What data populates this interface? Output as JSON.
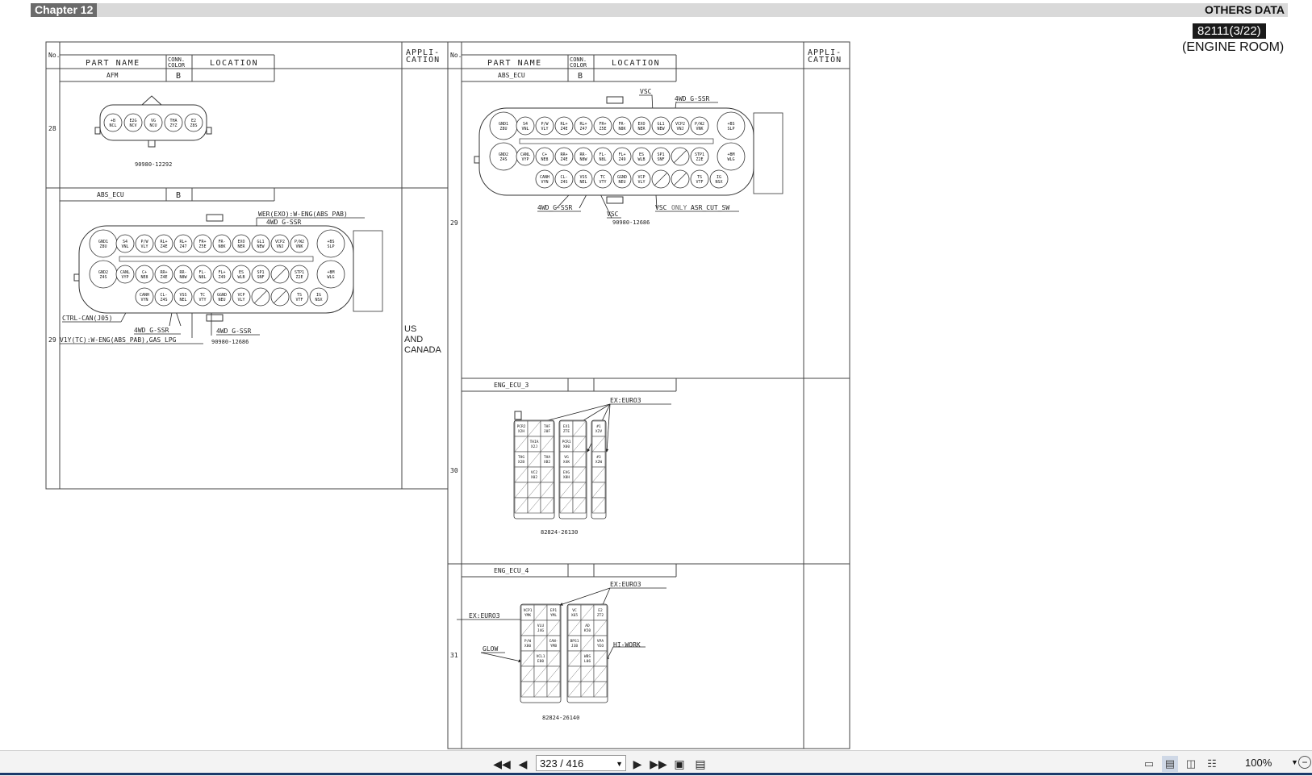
{
  "header": {
    "chapter": "Chapter 12",
    "section": "OTHERS DATA",
    "code": "82111(3/22)",
    "subtitle": "(ENGINE ROOM)"
  },
  "table": {
    "col_no": "No.",
    "col_part": "PART NAME",
    "col_conn1": "CONN.",
    "col_conn2": "COLOR",
    "col_location": "LOCATION",
    "col_app1": "APPLI-",
    "col_app2": "CATION"
  },
  "left": {
    "afm": {
      "no": "28",
      "part": "AFM",
      "color": "B",
      "partno": "90980-12292",
      "pins": [
        "+B\nNCL",
        "E2G\nNCV",
        "VG\nNCU",
        "THA\nZYZ",
        "E2\nZ8S"
      ]
    },
    "abs": {
      "no": "29",
      "part": "ABS_ECU",
      "color": "B",
      "partno": "90980-12686",
      "application": [
        "US",
        "AND",
        "CANADA"
      ],
      "callouts": [
        "WER(EXO):W-ENG(ABS_PAB)",
        "4WD_G-SSR",
        "CTRL-CAN(J05)",
        "4WD_G-SSR",
        "4WD_G-SSR",
        "V1Y(TC):W-ENG(ABS_PAB),GAS_LPG"
      ]
    }
  },
  "right": {
    "abs": {
      "no": "29",
      "part": "ABS_ECU",
      "color": "B",
      "partno": "90980-12686",
      "callouts": [
        "VSC",
        "4WD_G-SSR",
        "4WD_G-SSR",
        "VSC",
        "VSC",
        "ONLY",
        "ASR_CUT_SW"
      ]
    },
    "eng3": {
      "no": "30",
      "part": "ENG_ECU_3",
      "partno": "82824-26130",
      "callouts": [
        "EX:EURO3"
      ]
    },
    "eng4": {
      "no": "31",
      "part": "ENG_ECU_4",
      "partno": "82824-26140",
      "callouts": [
        "EX:EURO3",
        "EX:EURO3",
        "GLOW",
        "HI-WORK"
      ]
    }
  },
  "pins": {
    "abs_row1": [
      "GND1\nZ8U",
      "S4\nVNL",
      "P/W\nVLY",
      "RL+\nZ4E",
      "RL+\nZ47",
      "FR+\nZ5E",
      "FR-\nN8K",
      "EXO\nNER",
      "GL1\nNEW",
      "VCP2\nVNJ",
      "P/W2\nVNK",
      "+BS\nSLP"
    ],
    "abs_row2": [
      "GND2\nZ4S",
      "CANL\nVYP",
      "C+\nNE8",
      "RR+\nZ4E",
      "RR-\nN8W",
      "FL-\nN8L",
      "FL+\nZ49",
      "ES\nWLB",
      "SP1\nSNF",
      "",
      "STP1\nZ2E",
      "+BM\nWLG"
    ],
    "abs_row3": [
      "CANH\nVYN",
      "CL-\nZ4S",
      "VSS\nNEL",
      "TC\nVTY",
      "GGND\nNEU",
      "VCP\nVLY",
      "",
      "",
      "TS\nVTF",
      "IG\nNSX"
    ],
    "eng3_blocks": [
      "PCR2\nX2H",
      "THF\nJ0F",
      "THIA\nX2J",
      "THG\nX2B",
      "THA\nXB2",
      "VC2\nX02",
      "EX1\nZTE",
      "PCR1\nX00",
      "VG\nX4K",
      "EVG\nX8H",
      "INJF\nY81",
      "#1\nX2V",
      "#3\nX2W",
      "#2\nX2X",
      "#4\nXB1"
    ],
    "eng4_blocks": [
      "VCP1\nYMK",
      "EP1\nYML",
      "VLU\nJ4G",
      "P/W\nX80",
      "CAN-\nYMB",
      "VCL1\nE80",
      "VPA1\nX2K",
      "CAN+\nYMD",
      "VC\nX65",
      "E2\nZT2",
      "AD\nK50",
      "BPS1\nJ3B",
      "VPA\nYEO",
      "WBS\nL06",
      "EXTP\nYUV"
    ]
  },
  "toolbar": {
    "page": "323 / 416",
    "zoom": "100%"
  }
}
